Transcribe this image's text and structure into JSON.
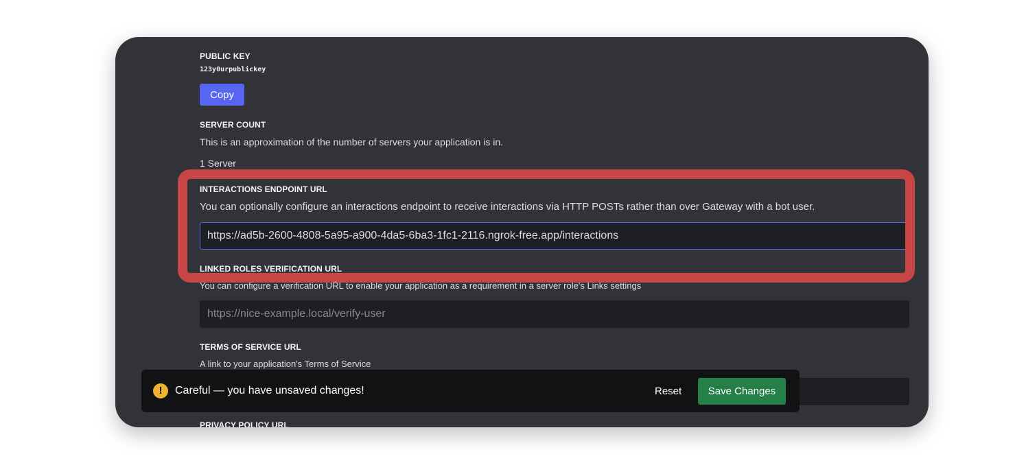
{
  "public_key": {
    "label": "PUBLIC KEY",
    "value": "123y0urpublickey",
    "copy_label": "Copy"
  },
  "server_count": {
    "label": "SERVER COUNT",
    "description": "This is an approximation of the number of servers your application is in.",
    "value": "1 Server"
  },
  "interactions_endpoint": {
    "label": "INTERACTIONS ENDPOINT URL",
    "description": "You can optionally configure an interactions endpoint to receive interactions via HTTP POSTs rather than over Gateway with a bot user.",
    "value": "https://ad5b-2600-4808-5a95-a900-4da5-6ba3-1fc1-2116.ngrok-free.app/interactions"
  },
  "linked_roles": {
    "label": "LINKED ROLES VERIFICATION URL",
    "description": "You can configure a verification URL to enable your application as a requirement in a server role's Links settings",
    "placeholder": "https://nice-example.local/verify-user"
  },
  "terms_of_service": {
    "label": "TERMS OF SERVICE URL",
    "description": "A link to your application's Terms of Service"
  },
  "privacy_policy": {
    "label": "PRIVACY POLICY URL"
  },
  "unsaved_toast": {
    "icon": "warning-icon",
    "message": "Careful — you have unsaved changes!",
    "reset_label": "Reset",
    "save_label": "Save Changes"
  },
  "colors": {
    "background": "#313338",
    "blurple": "#5865f2",
    "success": "#248046",
    "warning": "#f0b232",
    "highlight": "#c74545"
  }
}
